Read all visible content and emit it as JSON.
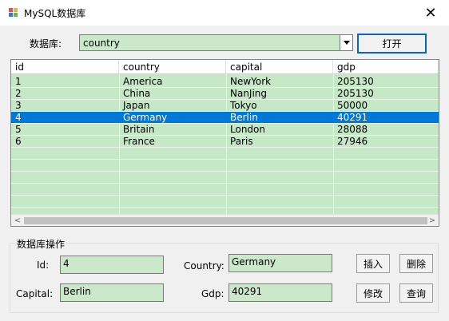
{
  "window": {
    "title": "MySQL数据库"
  },
  "toolbar": {
    "db_label": "数据库:",
    "db_value": "country",
    "open_label": "打开"
  },
  "table": {
    "columns": [
      "id",
      "country",
      "capital",
      "gdp"
    ],
    "rows": [
      [
        "1",
        "America",
        "NewYork",
        "205130"
      ],
      [
        "2",
        "China",
        "NanJing",
        "205130"
      ],
      [
        "3",
        "Japan",
        "Tokyo",
        "50000"
      ],
      [
        "4",
        "Germany",
        "Berlin",
        "40291"
      ],
      [
        "5",
        "Britain",
        "London",
        "28088"
      ],
      [
        "6",
        "France",
        "Paris",
        "27946"
      ]
    ],
    "selected_row": 3
  },
  "ops": {
    "title": "数据库操作",
    "id_label": "Id:",
    "id_value": "4",
    "country_label": "Country:",
    "country_value": "Germany",
    "capital_label": "Capital:",
    "capital_value": "Berlin",
    "gdp_label": "Gdp:",
    "gdp_value": "40291",
    "insert_label": "插入",
    "delete_label": "删除",
    "modify_label": "修改",
    "query_label": "查询"
  },
  "colors": {
    "field_bg": "#cbe8cb",
    "selection": "#0078d7"
  }
}
